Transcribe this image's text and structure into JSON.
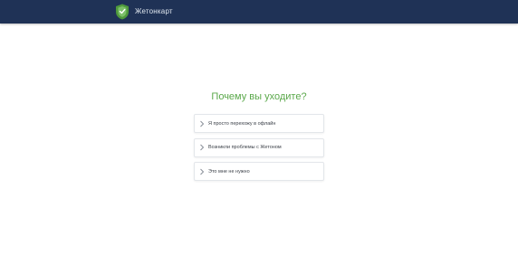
{
  "header": {
    "brand_name": "Жетонкарт",
    "logo_icon": "shield-logo-icon",
    "colors": {
      "background": "#1f3256",
      "logo_primary": "#4f9a3c"
    }
  },
  "main": {
    "title": "Почему вы уходите?",
    "title_color": "#5aa84a",
    "options": [
      {
        "label": "Я просто перехожу в офлайн",
        "icon": "chevron-right-icon"
      },
      {
        "label": "Возникли проблемы с Жетоном",
        "icon": "chevron-right-icon"
      },
      {
        "label": "Это мне не нужно",
        "icon": "chevron-right-icon"
      }
    ]
  }
}
